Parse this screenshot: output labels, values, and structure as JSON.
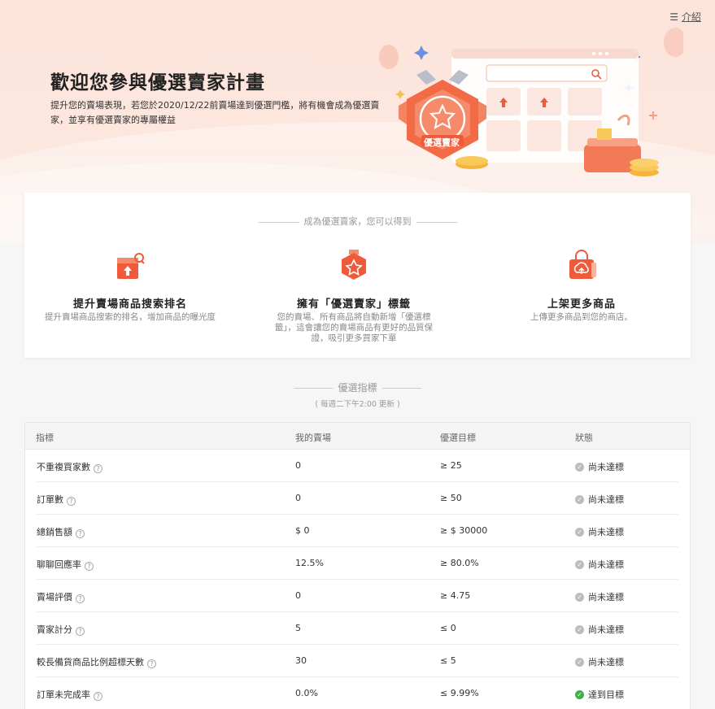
{
  "header": {
    "intro_label": "介紹",
    "title": "歡迎您參與優選賣家計畫",
    "description": "提升您的賣場表現，若您於2020/12/22前賣場達到優選門檻，將有機會成為優選賣家，並享有優選賣家的專屬權益",
    "badge_label": "優選賣家"
  },
  "benefits": {
    "heading": "成為優選賣家，您可以得到",
    "items": [
      {
        "title": "提升賣場商品搜索排名",
        "desc": "提升賣場商品搜索的排名，增加商品的曝光度",
        "icon": "search-rank-icon"
      },
      {
        "title": "擁有「優選賣家」標籤",
        "desc": "您的賣場、所有商品將自動新增「優選標籤」，這會讓您的賣場商品有更好的品質保證，吸引更多買家下單",
        "icon": "star-badge-icon"
      },
      {
        "title": "上架更多商品",
        "desc": "上傳更多商品到您的商店。",
        "icon": "upload-bag-icon"
      }
    ]
  },
  "metrics": {
    "heading": "優選指標",
    "subheading": "( 每週二下午2:00 更新 )",
    "columns": [
      "指標",
      "我的賣場",
      "優選目標",
      "狀態"
    ],
    "rows": [
      {
        "name": "不重複買家數",
        "mine": "0",
        "target": "≥ 25",
        "status": "尚未達標",
        "ok": false
      },
      {
        "name": "訂單數",
        "mine": "0",
        "target": "≥ 50",
        "status": "尚未達標",
        "ok": false
      },
      {
        "name": "總銷售額",
        "mine": "$ 0",
        "target": "≥ $ 30000",
        "status": "尚未達標",
        "ok": false
      },
      {
        "name": "聊聊回應率",
        "mine": "12.5%",
        "target": "≥ 80.0%",
        "status": "尚未達標",
        "ok": false
      },
      {
        "name": "賣場評價",
        "mine": "0",
        "target": "≥ 4.75",
        "status": "尚未達標",
        "ok": false
      },
      {
        "name": "賣家計分",
        "mine": "5",
        "target": "≤ 0",
        "status": "尚未達標",
        "ok": false
      },
      {
        "name": "較長備貨商品比例超標天數",
        "mine": "30",
        "target": "≤ 5",
        "status": "尚未達標",
        "ok": false
      },
      {
        "name": "訂單未完成率",
        "mine": "0.0%",
        "target": "≤ 9.99%",
        "status": "達到目標",
        "ok": true
      }
    ]
  },
  "colors": {
    "accent": "#ee5a3a",
    "ok": "#3ab44a",
    "pending": "#bdbdbd"
  }
}
